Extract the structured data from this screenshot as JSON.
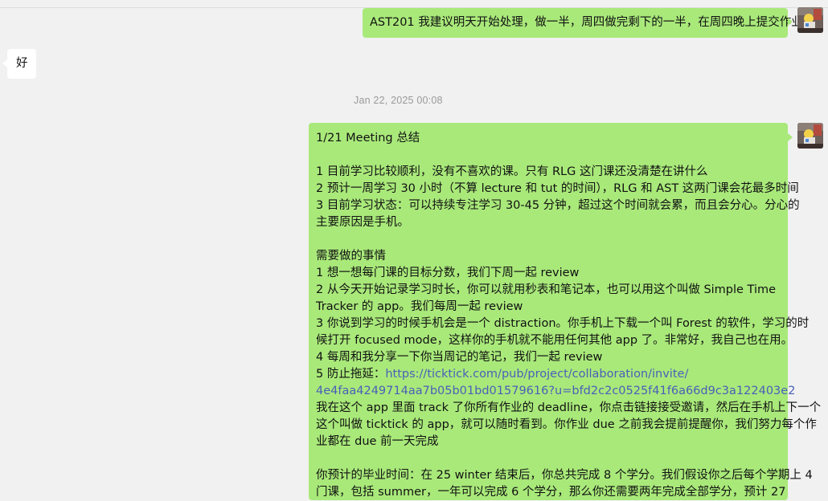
{
  "conversation": {
    "messages": [
      {
        "id": "m1",
        "direction": "outgoing",
        "text": "AST201 我建议明天开始处理，做一半，周四做完剩下的一半，在周四晚上提交作业"
      },
      {
        "id": "m2",
        "direction": "incoming",
        "text": "好"
      }
    ],
    "timestamp": "Jan 22, 2025 00:08",
    "long_message": {
      "direction": "outgoing",
      "lines": {
        "l1": "1/21 Meeting 总结",
        "l2": "1 目前学习比较顺利，没有不喜欢的课。只有 RLG 这门课还没清楚在讲什么",
        "l3": "2 预计一周学习 30 小时（不算 lecture 和 tut 的时间），RLG 和 AST 这两门课会花最多时间",
        "l4": "3 目前学习状态：可以持续专注学习 30-45 分钟，超过这个时间就会累，而且会分心。分心的",
        "l5": "主要原因是手机。",
        "l6": "需要做的事情",
        "l7": "1 想一想每门课的目标分数，我们下周一起 review",
        "l8": "2 从今天开始记录学习时长，你可以就用秒表和笔记本，也可以用这个叫做 Simple Time",
        "l9": "Tracker 的 app。我们每周一起 review",
        "l10": "3 你说到学习的时候手机会是一个 distraction。你手机上下载一个叫 Forest 的软件，学习的时",
        "l11": "候打开 focused mode，这样你的手机就不能用任何其他 app 了。非常好，我自己也在用。",
        "l12": "4 每周和我分享一下你当周记的笔记，我们一起 review",
        "l13_prefix": "5 防止拖延：",
        "l13_link": "https://ticktick.com/pub/project/collaboration/invite/",
        "l14_link": "4e4faa4249714aa7b05b01bd01579616?u=bfd2c2c0525f41f6a66d9c3a122403e2",
        "l15": "我在这个 app 里面 track 了你所有作业的 deadline，你点击链接接受邀请，然后在手机上下一个",
        "l16": "这个叫做 ticktick 的 app，就可以随时看到。你作业 due 之前我会提前提醒你，我们努力每个作",
        "l17": "业都在 due 前一天完成",
        "l18": "你预计的毕业时间：在 25 winter 结束后，你总共完成 8 个学分。我们假设你之后每个学期上 4",
        "l19": "门课，包括 summer，一年可以完成 6 个学分，那么你还需要两年完成全部学分，预计 27"
      }
    }
  },
  "colors": {
    "background": "#f1f1f1",
    "outgoing_bubble": "#a9e97a",
    "incoming_bubble": "#ffffff",
    "link": "#4a5fb8",
    "timestamp_text": "#9a9a9a"
  },
  "icons": {
    "avatar": "user-avatar-icon"
  }
}
